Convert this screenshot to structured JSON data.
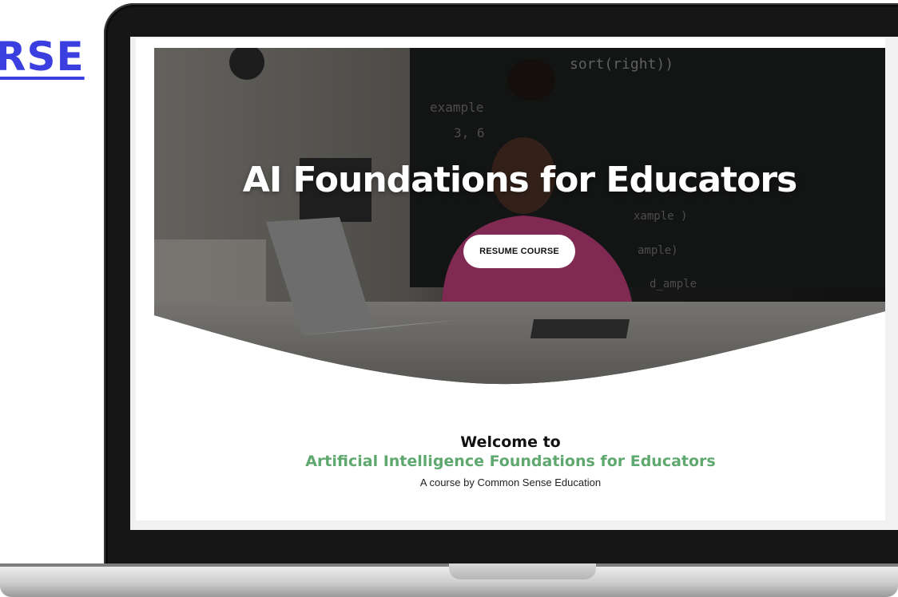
{
  "side_link": {
    "label": "RSE"
  },
  "hero": {
    "title": "AI Foundations for Educators",
    "button_label": "RESUME COURSE"
  },
  "welcome": {
    "line1": "Welcome to",
    "course_name": "Artificial Intelligence Foundations for Educators",
    "byline": "A course by Common Sense Education"
  },
  "colors": {
    "link": "#3b3fe0",
    "course_name": "#5fa86f",
    "hero_overlay": "#2b2a2a"
  }
}
